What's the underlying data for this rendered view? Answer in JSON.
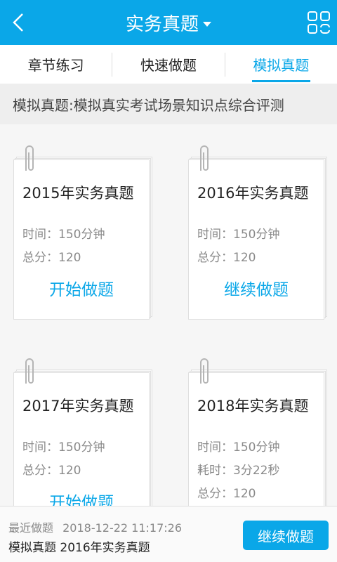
{
  "header": {
    "title": "实务真题"
  },
  "tabs": [
    {
      "label": "章节练习"
    },
    {
      "label": "快速做题"
    },
    {
      "label": "模拟真题"
    }
  ],
  "description": "模拟真题:模拟真实考试场景知识点综合评测",
  "papers": [
    {
      "title": "2015年实务真题",
      "lines": [
        "时间：150分钟",
        "总分：120"
      ],
      "action": "开始做题"
    },
    {
      "title": "2016年实务真题",
      "lines": [
        "时间：150分钟",
        "总分：120"
      ],
      "action": "继续做题"
    },
    {
      "title": "2017年实务真题",
      "lines": [
        "时间：150分钟",
        "总分：120"
      ],
      "action": "开始做题"
    },
    {
      "title": "2018年实务真题",
      "lines": [
        "时间：150分钟",
        "耗时：3分22秒",
        "总分：120"
      ],
      "action": ""
    }
  ],
  "bottom": {
    "recent_label": "最近做题",
    "recent_time": "2018-12-22 11:17:26",
    "recent_paper": "模拟真题 2016年实务真题",
    "button_label": "继续做题"
  },
  "colors": {
    "accent": "#0aa7e8"
  }
}
